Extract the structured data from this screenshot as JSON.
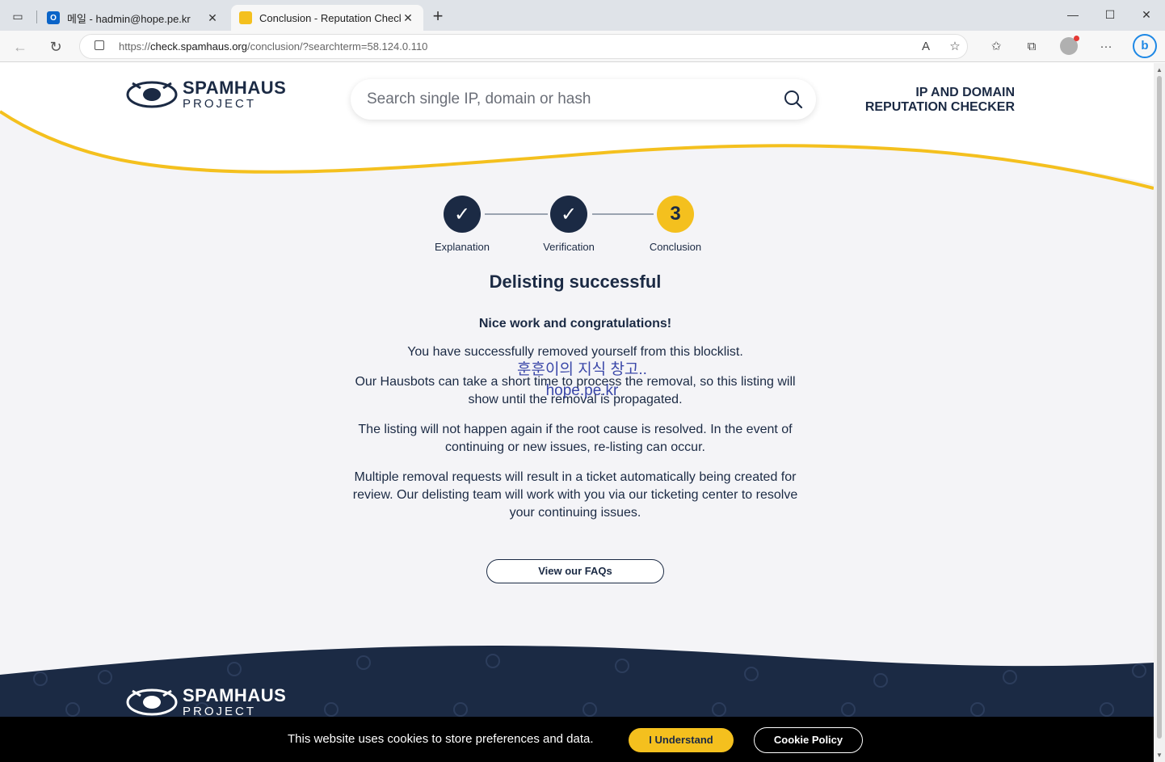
{
  "browser": {
    "tabs": [
      {
        "title": "메일 - hadmin@hope.pe.kr",
        "favicon": "outlook-icon",
        "active": false
      },
      {
        "title": "Conclusion - Reputation Checker",
        "favicon": "spamhaus-icon",
        "active": true
      }
    ],
    "url_prefix": "https://",
    "url_host": "check.spamhaus.org",
    "url_path": "/conclusion/?searchterm=58.124.0.110"
  },
  "header": {
    "logo_word1": "SPAMHAUS",
    "logo_word2": "PROJECT",
    "search_placeholder": "Search single IP, domain or hash",
    "tagline_line1": "IP AND DOMAIN",
    "tagline_line2": "REPUTATION CHECKER"
  },
  "steps": [
    {
      "label": "Explanation",
      "state": "done"
    },
    {
      "label": "Verification",
      "state": "done"
    },
    {
      "label": "Conclusion",
      "state": "current",
      "number": "3"
    }
  ],
  "content": {
    "title": "Delisting successful",
    "congrats": "Nice work and congratulations!",
    "p1": "You have successfully removed yourself from this blocklist.",
    "p2": "Our Hausbots can take a short time to process the removal, so this listing will show until the removal is propagated.",
    "p3": "The listing will not happen again if the root cause is resolved. In the event of continuing or new issues, re-listing can occur.",
    "p4": "Multiple removal requests will result in a ticket automatically being created for review. Our delisting team will work with you via our ticketing center to resolve your continuing issues.",
    "faq_button": "View our FAQs"
  },
  "watermark": {
    "line1": "훈훈이의 지식 창고..",
    "line2": "hope.pe.kr"
  },
  "footer": {
    "logo_word1": "SPAMHAUS",
    "logo_word2": "PROJECT"
  },
  "cookie": {
    "message": "This website uses cookies to store preferences and data.",
    "accept": "I Understand",
    "policy": "Cookie Policy"
  },
  "colors": {
    "navy": "#1b2a44",
    "yellow": "#f4c01e"
  }
}
